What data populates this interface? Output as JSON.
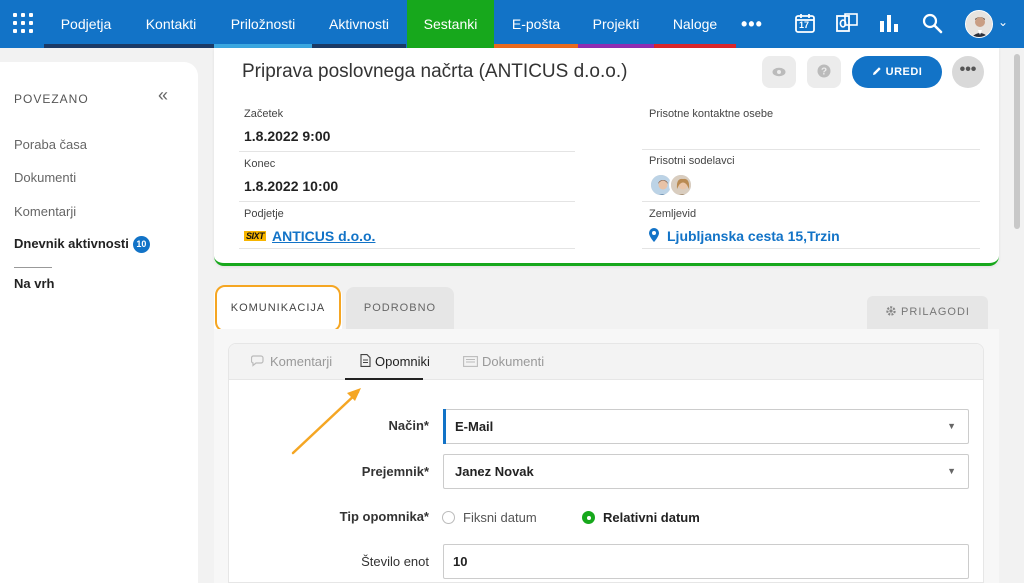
{
  "topnav": {
    "items": [
      {
        "label": "Podjetja",
        "bar": "#1b3a66"
      },
      {
        "label": "Kontakti",
        "bar": "#1b3a66"
      },
      {
        "label": "Priložnosti",
        "bar": "#3aa7e0"
      },
      {
        "label": "Aktivnosti",
        "bar": "#1b3a66"
      },
      {
        "label": "Sestanki",
        "bar": "#17a81c"
      },
      {
        "label": "E-pošta",
        "bar": "#e86a1e"
      },
      {
        "label": "Projekti",
        "bar": "#8e2db3"
      },
      {
        "label": "Naloge",
        "bar": "#d9262b"
      }
    ],
    "more": "•••",
    "calendar_day": "17",
    "icons": [
      "apps-grid-icon",
      "calendar-icon",
      "outlook-icon",
      "reports-icon",
      "search-icon",
      "user-avatar"
    ]
  },
  "sidebar": {
    "heading": "POVEZANO",
    "items": [
      {
        "label": "Poraba časa"
      },
      {
        "label": "Dokumenti"
      },
      {
        "label": "Komentarji"
      },
      {
        "label": "Dnevnik aktivnosti",
        "badge": "10"
      }
    ],
    "back_to_top": "Na vrh"
  },
  "record": {
    "title": "Priprava poslovnega načrta (ANTICUS d.o.o.)",
    "edit_label": "UREDI",
    "start_label": "Začetek",
    "start_value": "1.8.2022 9:00",
    "end_label": "Konec",
    "end_value": "1.8.2022 10:00",
    "company_label": "Podjetje",
    "company_logo": "SIXT",
    "company_value": "ANTICUS d.o.o.",
    "contacts_label": "Prisotne kontaktne osebe",
    "colleagues_label": "Prisotni sodelavci",
    "location_label": "Zemljevid",
    "location_value": "Ljubljanska cesta 15,Trzin"
  },
  "tabs": {
    "communication": "KOMUNIKACIJA",
    "details": "PODROBNO",
    "customize": "PRILAGODI"
  },
  "subtabs": {
    "comments": "Komentarji",
    "reminders": "Opomniki",
    "documents": "Dokumenti"
  },
  "form": {
    "method_label": "Način*",
    "method_value": "E-Mail",
    "recipient_label": "Prejemnik*",
    "recipient_value": "Janez Novak",
    "type_label": "Tip opomnika*",
    "type_option_fixed": "Fiksni datum",
    "type_option_relative": "Relativni datum",
    "units_label": "Število enot",
    "units_value": "10"
  },
  "colors": {
    "primary": "#1273c7",
    "active_module": "#17a81c",
    "highlight": "#f5a623"
  }
}
